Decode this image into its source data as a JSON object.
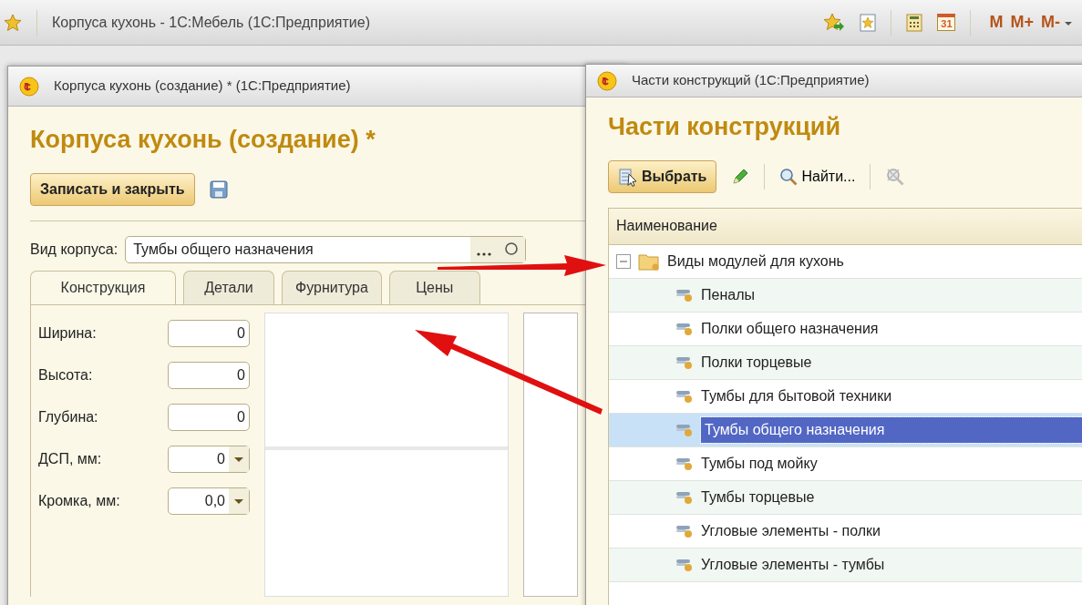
{
  "app_bar": {
    "title": "Корпуса кухонь - 1С:Мебель  (1С:Предприятие)",
    "calendar_day": "31",
    "memory_keys": [
      "M",
      "M+",
      "M-"
    ]
  },
  "form_window": {
    "title": "Корпуса кухонь (создание) *  (1С:Предприятие)",
    "heading": "Корпуса кухонь (создание) *",
    "save_close_button": "Записать и закрыть",
    "kind_field": {
      "label": "Вид корпуса:",
      "value": "Тумбы общего назначения"
    },
    "tabs": [
      {
        "label": "Конструкция",
        "selected": true
      },
      {
        "label": "Детали",
        "selected": false
      },
      {
        "label": "Фурнитура",
        "selected": false
      },
      {
        "label": "Цены",
        "selected": false
      }
    ],
    "fields": [
      {
        "label": "Ширина:",
        "value": "0",
        "kind": "number"
      },
      {
        "label": "Высота:",
        "value": "0",
        "kind": "number"
      },
      {
        "label": "Глубина:",
        "value": "0",
        "kind": "number"
      },
      {
        "label": "ДСП, мм:",
        "value": "0",
        "kind": "dropdown"
      },
      {
        "label": "Кромка, мм:",
        "value": "0,0",
        "kind": "dropdown"
      }
    ]
  },
  "list_window": {
    "title": "Части конструкций  (1С:Предприятие)",
    "heading": "Части конструкций",
    "select_button": "Выбрать",
    "find_button": "Найти...",
    "tree": {
      "column": "Наименование",
      "items": [
        {
          "label": "Виды модулей для кухонь",
          "expanded": true,
          "selected": false,
          "children": [
            {
              "label": "Пеналы",
              "selected": false
            },
            {
              "label": "Полки общего назначения",
              "selected": false
            },
            {
              "label": "Полки торцевые",
              "selected": false
            },
            {
              "label": "Тумбы для бытовой техники",
              "selected": false
            },
            {
              "label": "Тумбы общего назначения",
              "selected": true
            },
            {
              "label": "Тумбы под мойку",
              "selected": false
            },
            {
              "label": "Тумбы торцевые",
              "selected": false
            },
            {
              "label": "Угловые элементы - полки",
              "selected": false
            },
            {
              "label": "Угловые элементы - тумбы",
              "selected": false
            }
          ]
        }
      ]
    }
  }
}
